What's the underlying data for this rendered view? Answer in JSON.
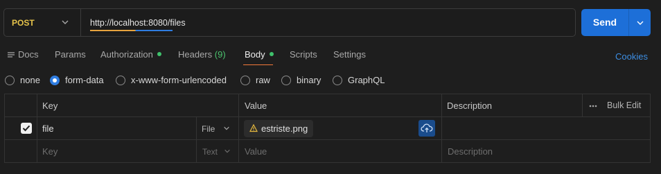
{
  "request": {
    "method": "POST",
    "url": "http://localhost:8080/files",
    "send_label": "Send"
  },
  "tabs": [
    {
      "label": "Docs"
    },
    {
      "label": "Params"
    },
    {
      "label": "Authorization"
    },
    {
      "label": "Headers",
      "count": "(9)"
    },
    {
      "label": "Body"
    },
    {
      "label": "Scripts"
    },
    {
      "label": "Settings"
    }
  ],
  "active_tab": "Body",
  "cookies_label": "Cookies",
  "body_types": [
    {
      "label": "none",
      "checked": false
    },
    {
      "label": "form-data",
      "checked": true
    },
    {
      "label": "x-www-form-urlencoded",
      "checked": false
    },
    {
      "label": "raw",
      "checked": false
    },
    {
      "label": "binary",
      "checked": false
    },
    {
      "label": "GraphQL",
      "checked": false
    }
  ],
  "table": {
    "headers": {
      "key": "Key",
      "value": "Value",
      "description": "Description",
      "bulk_edit": "Bulk Edit"
    },
    "rows": [
      {
        "checked": true,
        "key": "file",
        "type": "File",
        "value_file": "estriste.png",
        "description": ""
      }
    ],
    "empty_row": {
      "key_placeholder": "Key",
      "type": "Text",
      "value_placeholder": "Value",
      "description_placeholder": "Description"
    }
  },
  "colors": {
    "accent": "#1d6fd8",
    "method": "#e6c34a",
    "active_tab_underline": "#f47a3a",
    "status_dot": "#3fc16c",
    "link": "#3d8ee3"
  },
  "icons": [
    "chevron-down-icon",
    "docs-icon",
    "check-icon",
    "warning-icon",
    "cloud-upload-icon",
    "more-icon"
  ]
}
